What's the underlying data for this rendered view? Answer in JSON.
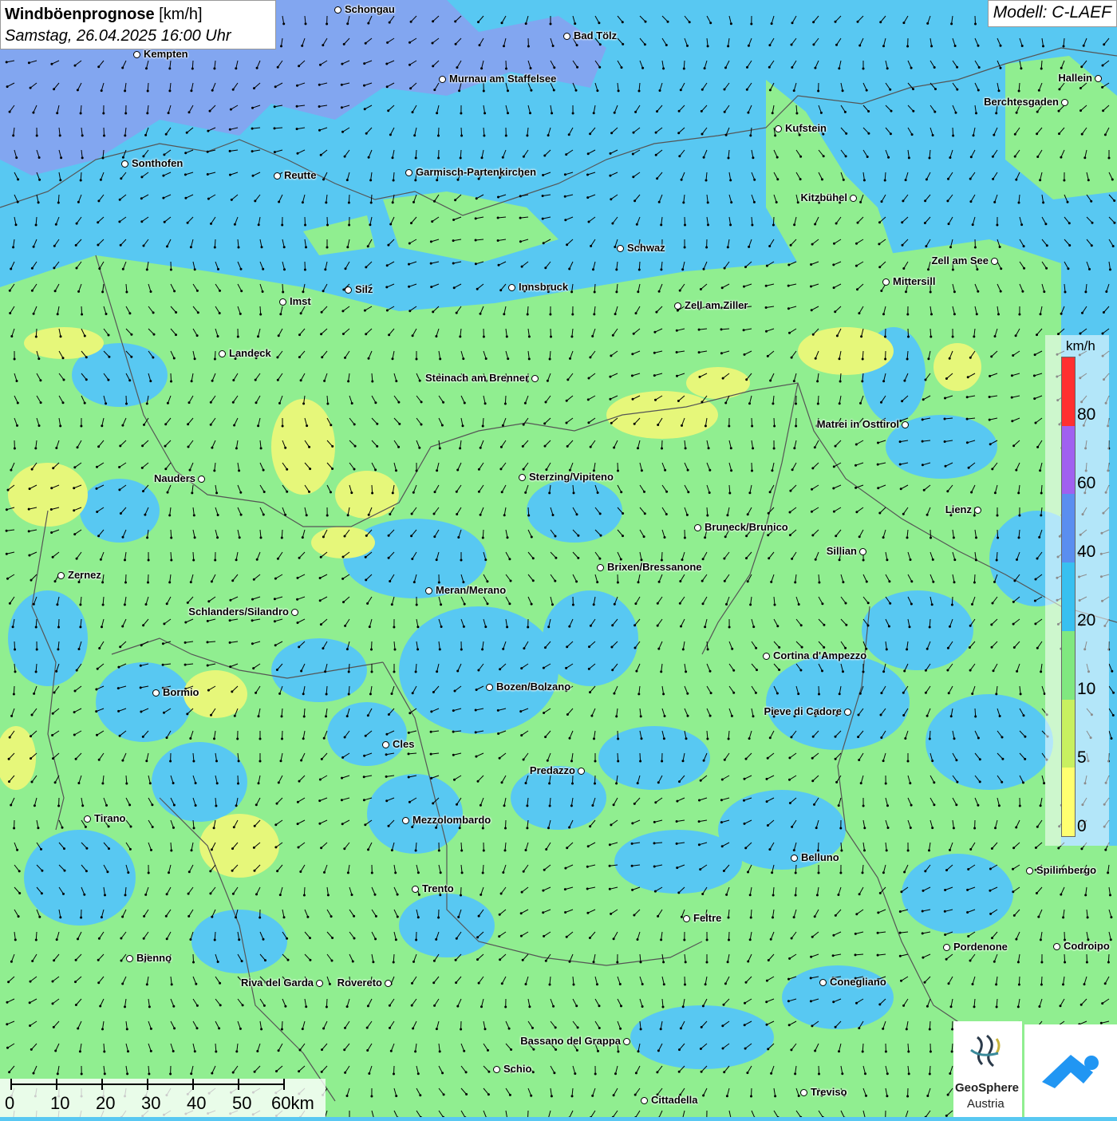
{
  "header": {
    "title_bold": "Windböenprognose",
    "title_unit": " [km/h]",
    "datetime": "Samstag, 26.04.2025 16:00 Uhr",
    "model": "Modell: C-LAEF"
  },
  "legend": {
    "unit": "km/h",
    "labels": [
      "80",
      "60",
      "40",
      "20",
      "10",
      "5",
      "0"
    ],
    "colors": [
      "#ff3030",
      "#a060f0",
      "#5a8ef0",
      "#38c0f0",
      "#80e880",
      "#c8f060",
      "#ffff70"
    ]
  },
  "map": {
    "colors": {
      "blue": "#58c8f2",
      "green": "#90ee90",
      "yellow": "#e6f77a",
      "violet": "#8aa0f0",
      "border": "#555555"
    }
  },
  "cities": [
    {
      "name": "Schongau"
    },
    {
      "name": "Bad Tölz"
    },
    {
      "name": "Kempten"
    },
    {
      "name": "Murnau am Staffelsee"
    },
    {
      "name": "Hallein"
    },
    {
      "name": "Berchtesgaden"
    },
    {
      "name": "Kufstein"
    },
    {
      "name": "Sonthofen"
    },
    {
      "name": "Reutte"
    },
    {
      "name": "Garmisch-Partenkirchen"
    },
    {
      "name": "Kitzbühel"
    },
    {
      "name": "Schwaz"
    },
    {
      "name": "Zell am See"
    },
    {
      "name": "Mittersill"
    },
    {
      "name": "Silz"
    },
    {
      "name": "Innsbruck"
    },
    {
      "name": "Imst"
    },
    {
      "name": "Zell am Ziller"
    },
    {
      "name": "Landeck"
    },
    {
      "name": "Steinach am Brenner"
    },
    {
      "name": "Matrei in Osttirol"
    },
    {
      "name": "Nauders"
    },
    {
      "name": "Sterzing/Vipiteno"
    },
    {
      "name": "Lienz"
    },
    {
      "name": "Bruneck/Brunico"
    },
    {
      "name": "Sillian"
    },
    {
      "name": "Zernez"
    },
    {
      "name": "Brixen/Bressanone"
    },
    {
      "name": "Meran/Merano"
    },
    {
      "name": "Schlanders/Silandro"
    },
    {
      "name": "Cortina d'Ampezzo"
    },
    {
      "name": "Bormio"
    },
    {
      "name": "Bozen/Bolzano"
    },
    {
      "name": "Pieve di Cadore"
    },
    {
      "name": "Cles"
    },
    {
      "name": "Predazzo"
    },
    {
      "name": "Tirano"
    },
    {
      "name": "Mezzolombardo"
    },
    {
      "name": "Belluno"
    },
    {
      "name": "Spilimbergo"
    },
    {
      "name": "Trento"
    },
    {
      "name": "Feltre"
    },
    {
      "name": "Pordenone"
    },
    {
      "name": "Codroipo"
    },
    {
      "name": "Bienno"
    },
    {
      "name": "Riva del Garda"
    },
    {
      "name": "Rovereto"
    },
    {
      "name": "Conegliano"
    },
    {
      "name": "Bassano del Grappa"
    },
    {
      "name": "Schio"
    },
    {
      "name": "Treviso"
    },
    {
      "name": "Cittadella"
    }
  ],
  "scalebar": {
    "labels": [
      "0",
      "10",
      "20",
      "30",
      "40",
      "50",
      "60km"
    ]
  },
  "logos": {
    "geosphere_name": "GeoSphere",
    "geosphere_sub": "Austria"
  }
}
